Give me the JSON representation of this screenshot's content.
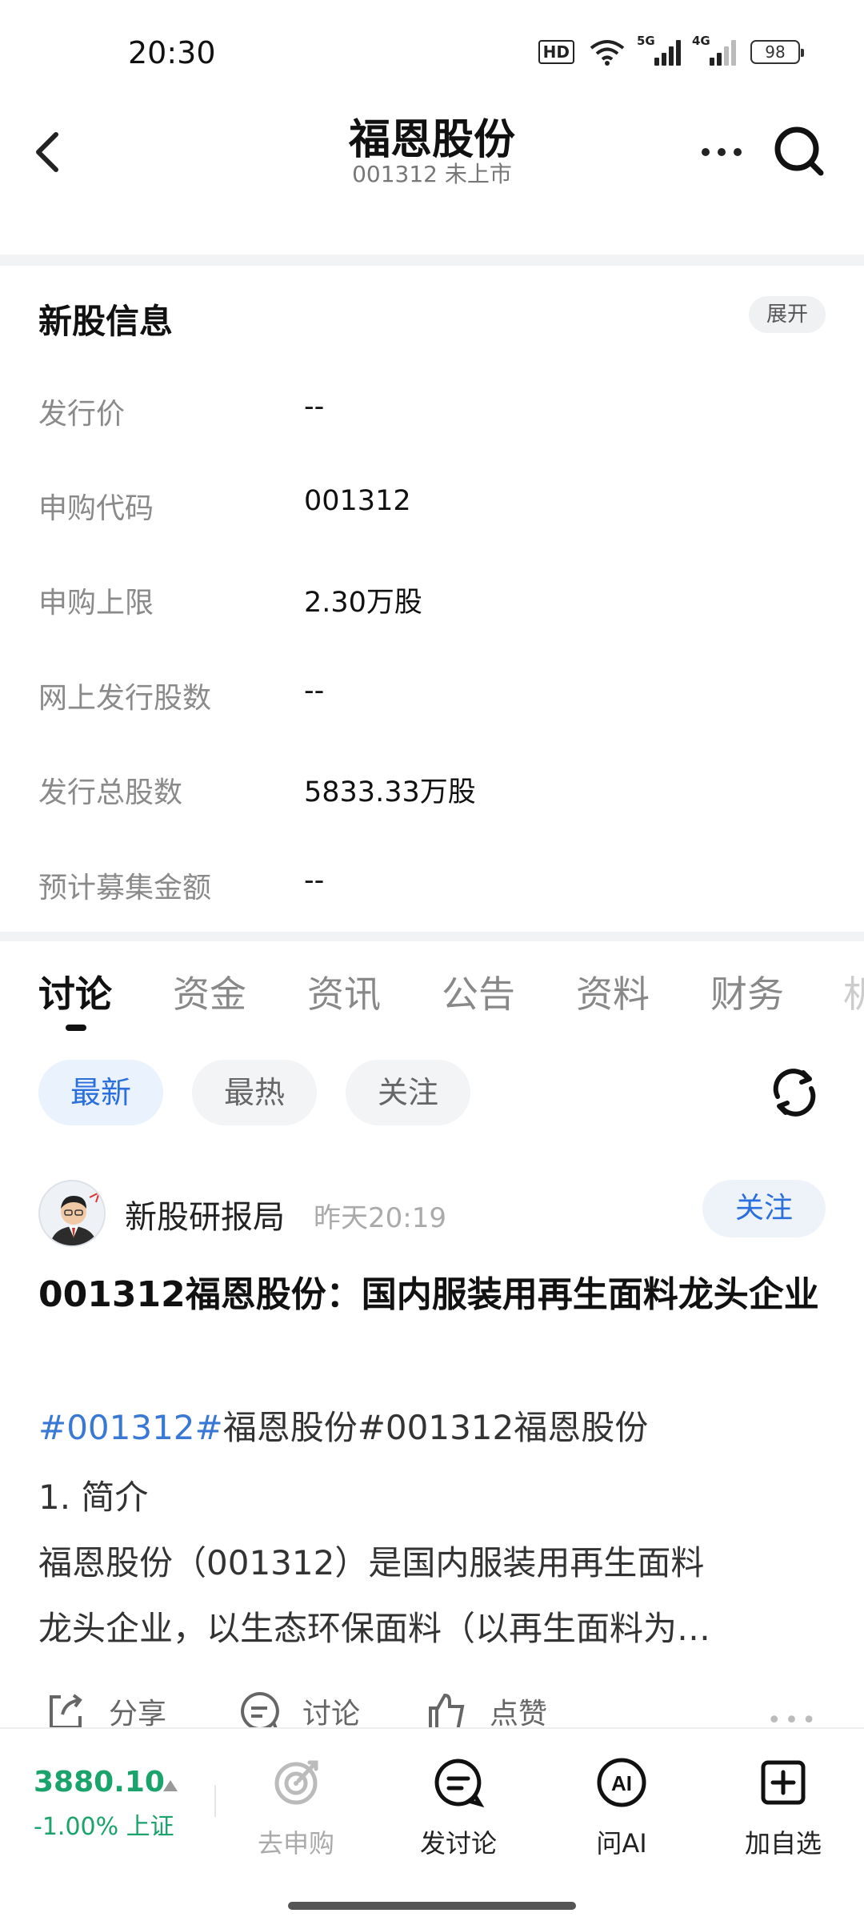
{
  "status_bar": {
    "time": "20:30",
    "hd_label": "HD",
    "net1_label": "5G",
    "net2_label": "4G",
    "battery": "98"
  },
  "header": {
    "title": "福恩股份",
    "subtitle": "001312 未上市"
  },
  "info": {
    "title": "新股信息",
    "expand_label": "展开",
    "rows": [
      {
        "label": "发行价",
        "value": "--"
      },
      {
        "label": "申购代码",
        "value": "001312"
      },
      {
        "label": "申购上限",
        "value": "2.30万股"
      },
      {
        "label": "网上发行股数",
        "value": "--"
      },
      {
        "label": "发行总股数",
        "value": "5833.33万股"
      },
      {
        "label": "预计募集金额",
        "value": "--"
      }
    ]
  },
  "tabs": [
    "讨论",
    "资金",
    "资讯",
    "公告",
    "资料",
    "财务",
    "机"
  ],
  "filters": [
    "最新",
    "最热",
    "关注"
  ],
  "post": {
    "author": "新股研报局",
    "time": "昨天20:19",
    "follow_label": "关注",
    "title": "001312福恩股份：国内服装用再生面料龙头企业",
    "tag_link": "#001312#",
    "tag_rest": "福恩股份#001312福恩股份",
    "body_line1": "1. 简介",
    "body_line2": "福恩股份（001312）是国内服装用再生面料",
    "body_line3": "龙头企业，以生态环保面料（以再生面料为…",
    "actions": {
      "share": "分享",
      "discuss": "讨论",
      "like": "点赞"
    }
  },
  "bottom_bar": {
    "index_value": "3880.10",
    "index_change": "-1.00% 上证",
    "nav": [
      {
        "label": "去申购",
        "icon": "subscribe-icon"
      },
      {
        "label": "发讨论",
        "icon": "chat-icon"
      },
      {
        "label": "问AI",
        "icon": "ai-icon"
      },
      {
        "label": "加自选",
        "icon": "add-favorite-icon"
      }
    ]
  }
}
